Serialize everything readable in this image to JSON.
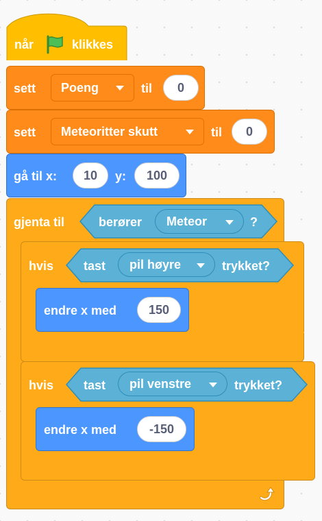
{
  "hat": {
    "prefix": "når",
    "suffix": "klikkes",
    "icon": "green-flag-icon"
  },
  "set1": {
    "label": "sett",
    "variable": "Poeng",
    "to_label": "til",
    "value": "0"
  },
  "set2": {
    "label": "sett",
    "variable": "Meteoritter skutt",
    "to_label": "til",
    "value": "0"
  },
  "goto": {
    "label": "gå til x:",
    "x": "10",
    "y_label": "y:",
    "y": "100"
  },
  "repeat": {
    "label": "gjenta til",
    "condition": {
      "label": "berører",
      "object": "Meteor",
      "suffix": "?"
    },
    "loop_icon": "repeat-arrow-icon"
  },
  "if1": {
    "label": "hvis",
    "condition": {
      "prefix": "tast",
      "key": "pil høyre",
      "suffix": "trykket?"
    },
    "action": {
      "label": "endre x med",
      "value": "150"
    }
  },
  "if2": {
    "label": "hvis",
    "condition": {
      "prefix": "tast",
      "key": "pil venstre",
      "suffix": "trykket?"
    },
    "action": {
      "label": "endre x med",
      "value": "-150"
    }
  },
  "colors": {
    "events": "#FFBF00",
    "variables": "#FF8C1A",
    "motion": "#4C97FF",
    "control": "#FFAB19",
    "sensing": "#5CB1D6"
  }
}
